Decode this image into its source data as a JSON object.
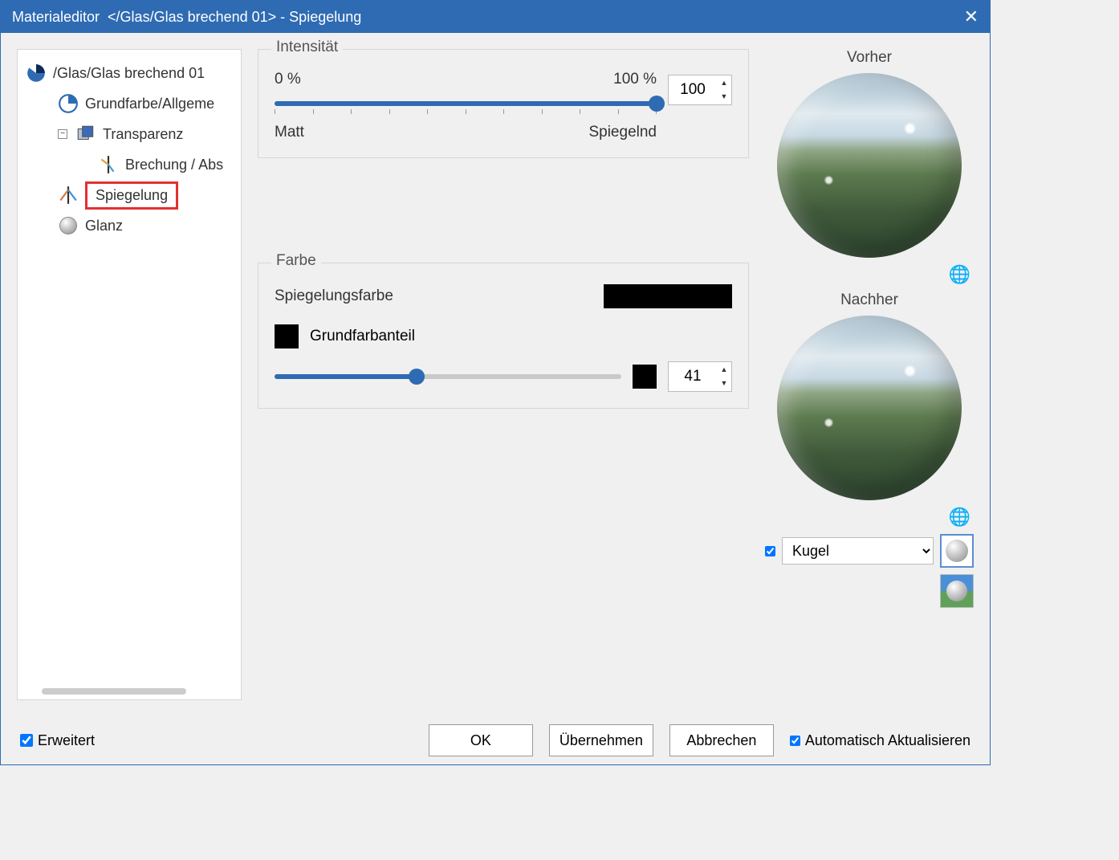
{
  "titlebar": {
    "app": "Materialeditor",
    "path": "</Glas/Glas brechend 01> - Spiegelung"
  },
  "tree": {
    "root": "/Glas/Glas brechend 01",
    "items": [
      {
        "label": "Grundfarbe/Allgeme"
      },
      {
        "label": "Transparenz"
      },
      {
        "label": "Brechung / Abs"
      },
      {
        "label": "Spiegelung"
      },
      {
        "label": "Glanz"
      }
    ]
  },
  "intensity": {
    "legend": "Intensität",
    "min_label": "0 %",
    "max_label": "100 %",
    "left_word": "Matt",
    "right_word": "Spiegelnd",
    "value": "100"
  },
  "color": {
    "legend": "Farbe",
    "reflection_label": "Spiegelungsfarbe",
    "base_label": "Grundfarbanteil",
    "base_value": "41",
    "reflection_hex": "#000000",
    "base_hex": "#000000"
  },
  "preview": {
    "before": "Vorher",
    "after": "Nachher",
    "shape_options": [
      "Kugel"
    ],
    "shape_selected": "Kugel"
  },
  "footer": {
    "extended": "Erweitert",
    "ok": "OK",
    "apply": "Übernehmen",
    "cancel": "Abbrechen",
    "auto_update": "Automatisch Aktualisieren"
  }
}
